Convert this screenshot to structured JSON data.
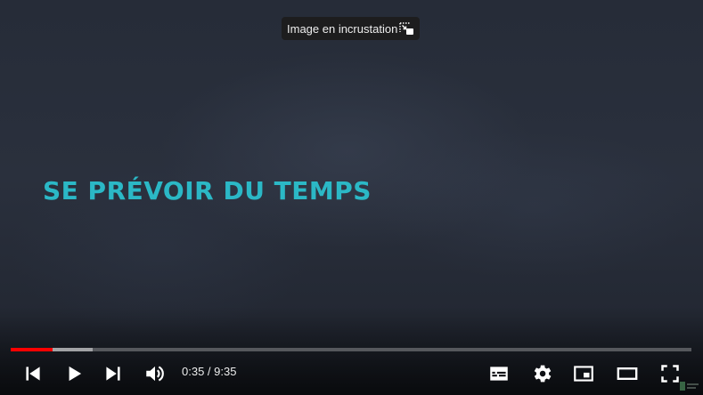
{
  "video": {
    "title": "SE PRÉVOIR DU TEMPS"
  },
  "tooltip": {
    "label": "Image en incrustation",
    "icon": "pip-icon"
  },
  "progress": {
    "played_fraction": 0.0614,
    "loaded_fraction": 0.12
  },
  "controls": {
    "time_current": "0:35",
    "time_separator": " / ",
    "time_total": "9:35",
    "icons": [
      "previous-icon",
      "play-icon",
      "next-icon",
      "volume-icon",
      "subtitles-icon",
      "settings-icon",
      "miniplayer-icon",
      "theater-icon",
      "fullscreen-icon"
    ]
  },
  "colors": {
    "title": "#2bb8c6",
    "progress_played": "#ff0000",
    "background": "#262c38"
  }
}
